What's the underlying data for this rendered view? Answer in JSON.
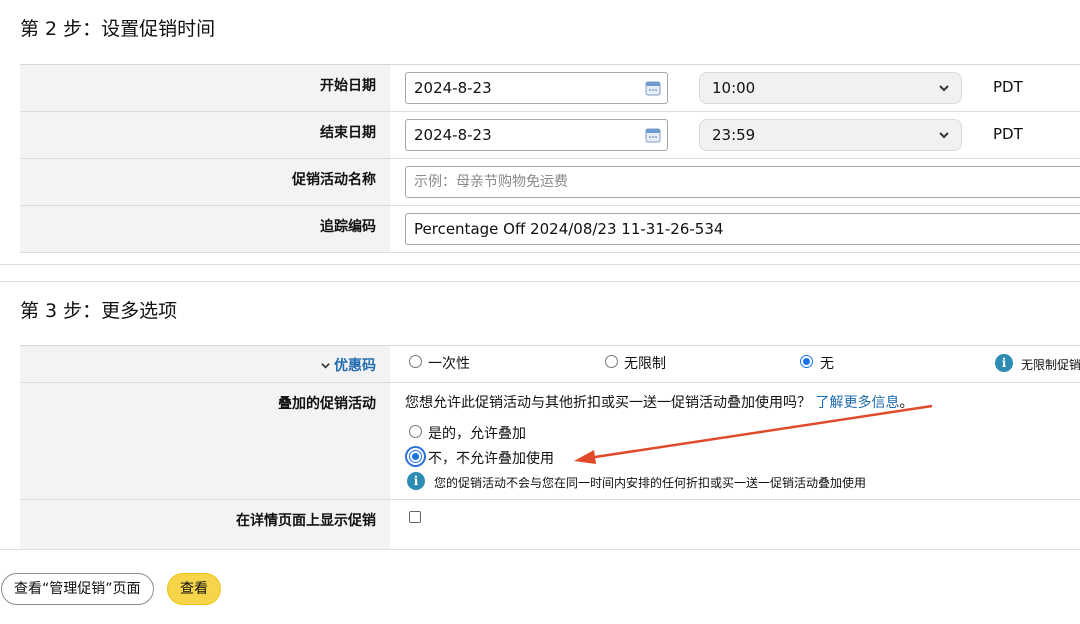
{
  "step2": {
    "title": "第 2 步：设置促销时间",
    "start": {
      "label": "开始日期",
      "date": "2024-8-23",
      "time": "10:00",
      "timezone": "PDT"
    },
    "end": {
      "label": "结束日期",
      "date": "2024-8-23",
      "time": "23:59",
      "timezone": "PDT"
    },
    "name": {
      "label": "促销活动名称",
      "placeholder": "示例：母亲节购物免运费"
    },
    "tracking": {
      "label": "追踪编码",
      "value": "Percentage Off 2024/08/23 11-31-26-534"
    }
  },
  "step3": {
    "title": "第 3 步：更多选项",
    "coupon": {
      "label": "优惠码",
      "options": [
        "一次性",
        "无限制",
        "无"
      ],
      "selected": "无",
      "info_text": "无限制促销"
    },
    "stacking": {
      "label": "叠加的促销活动",
      "question": "您想允许此促销活动与其他折扣或买一送一促销活动叠加使用吗？",
      "learn_more": "了解更多信息",
      "trailing": "。",
      "options": [
        "是的，允许叠加",
        "不，不允许叠加使用"
      ],
      "selected": "不，不允许叠加使用",
      "info_text": "您的促销活动不会与您在同一时间内安排的任何折扣或买一送一促销活动叠加使用"
    },
    "display": {
      "label": "在详情页面上显示促销",
      "checked": false
    }
  },
  "footer": {
    "manage_button": "查看“管理促销”页面",
    "view_button": "查看"
  },
  "colors": {
    "accent": "#1a73e8",
    "arrow": "#e04a2b",
    "primary_button": "#f6d54a",
    "link": "#1f6bb0"
  }
}
